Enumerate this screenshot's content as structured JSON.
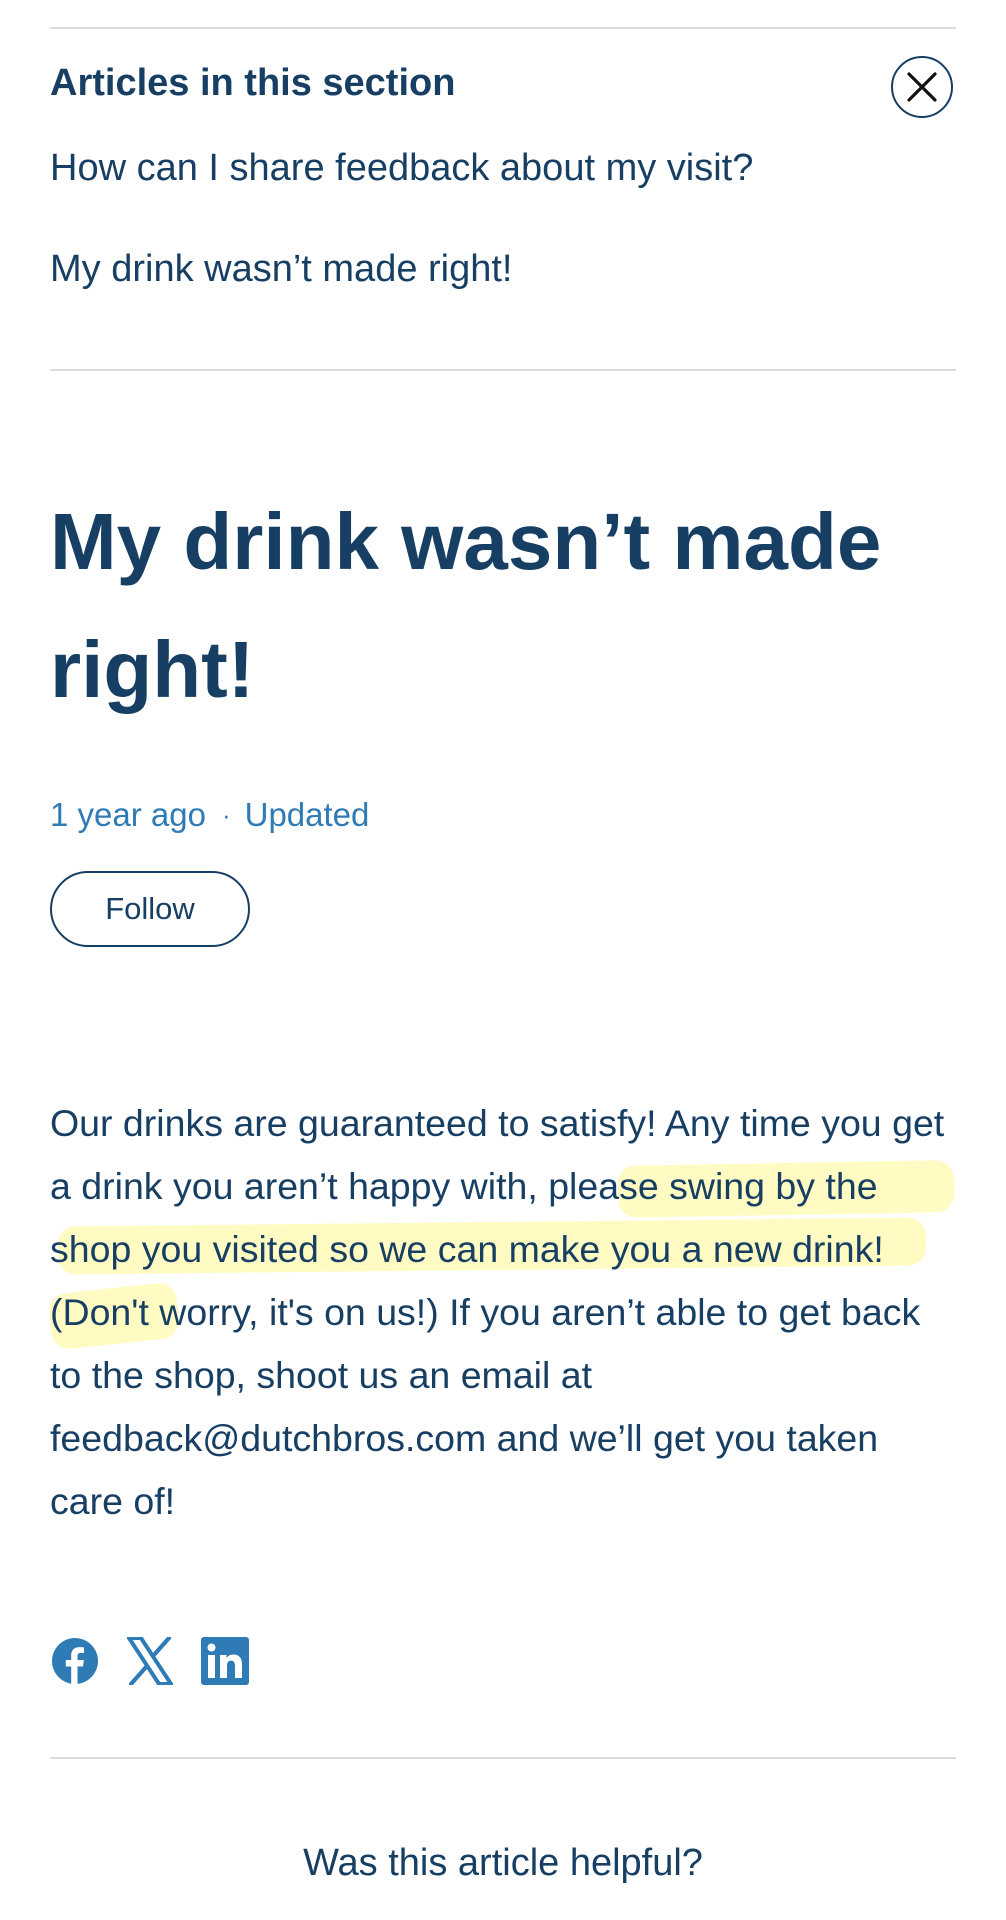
{
  "section": {
    "heading": "Articles in this section",
    "close_label": "Close",
    "links": [
      "How can I share feedback about my visit?",
      "My drink wasn’t made right!"
    ]
  },
  "article": {
    "title": "My drink wasn’t made right!",
    "meta": {
      "age": "1 year ago",
      "separator": "·",
      "updated": "Updated"
    },
    "follow_label": "Follow",
    "body": "Our drinks are guaranteed to satisfy! Any time you get a drink you aren’t happy with, please swing by the shop you visited so we can make you a new drink! (Don't worry, it's on us!) If you aren’t able to get back to the shop, shoot us an email at feedback@dutchbros.com and we’ll get you taken care of!"
  },
  "share": {
    "icons": [
      "facebook-icon",
      "x-icon",
      "linkedin-icon"
    ]
  },
  "feedback": {
    "question": "Was this article helpful?"
  },
  "colors": {
    "text": "#173e63",
    "meta": "#2e7bb5",
    "icon": "#2e7bb5",
    "highlight": "#fff678"
  }
}
